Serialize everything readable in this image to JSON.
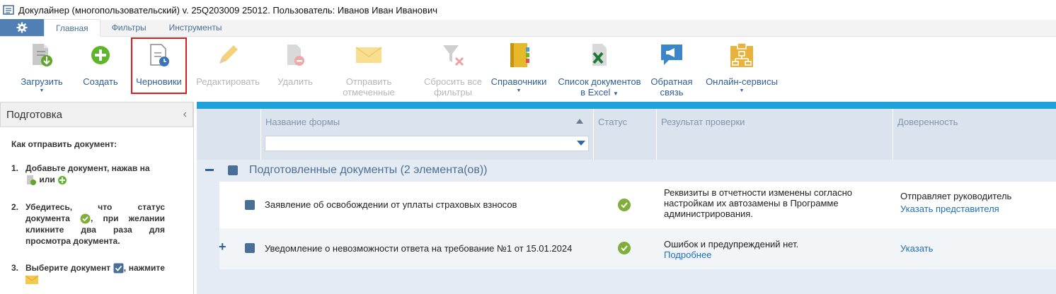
{
  "window": {
    "title": "Докулайнер (многопользовательский) v. 25Q203009 25012. Пользователь: Иванов Иван Иванович"
  },
  "tabs": [
    {
      "label": "Главная",
      "active": true
    },
    {
      "label": "Фильтры",
      "active": false
    },
    {
      "label": "Инструменты",
      "active": false
    }
  ],
  "ribbon": {
    "load": "Загрузить",
    "create": "Создать",
    "drafts": "Черновики",
    "edit": "Редактировать",
    "delete": "Удалить",
    "send_line1": "Отправить",
    "send_line2": "отмеченные",
    "reset_line1": "Сбросить все",
    "reset_line2": "фильтры",
    "directories": "Справочники",
    "excel_line1": "Список документов",
    "excel_line2": "в Excel",
    "feedback_line1": "Обратная",
    "feedback_line2": "связь",
    "online": "Онлайн-сервисы"
  },
  "left_panel": {
    "title": "Подготовка",
    "intro": "Как отправить документ:",
    "step1_num": "1.",
    "step1_text": "Добавьте документ, нажав на",
    "step1_or": "или",
    "step2_num": "2.",
    "step2_a": "Убедитесь, что статус документа",
    "step2_b": ", при желании кликните два раза для просмотра документа.",
    "step3_num": "3.",
    "step3_a": "Выберите документ",
    "step3_b": ", нажмите"
  },
  "grid": {
    "columns": {
      "form_name": "Название формы",
      "status": "Статус",
      "check_result": "Результат проверки",
      "trust": "Доверенность"
    },
    "group_label": "Подготовленные документы (2 элемента(ов))",
    "rows": [
      {
        "name": "Заявление об освобождении от уплаты страховых взносов",
        "result": "Реквизиты в отчетности изменены согласно настройкам их автозамены в Программе администрирования.",
        "result_link": "",
        "trust_text": "Отправляет руководитель",
        "trust_link": "Указать представителя"
      },
      {
        "name": "Уведомление о невозможности ответа на требование №1 от 15.01.2024",
        "result": "Ошибок и предупреждений нет.",
        "result_link": "Подробнее",
        "trust_text": "",
        "trust_link": "Указать"
      }
    ]
  }
}
